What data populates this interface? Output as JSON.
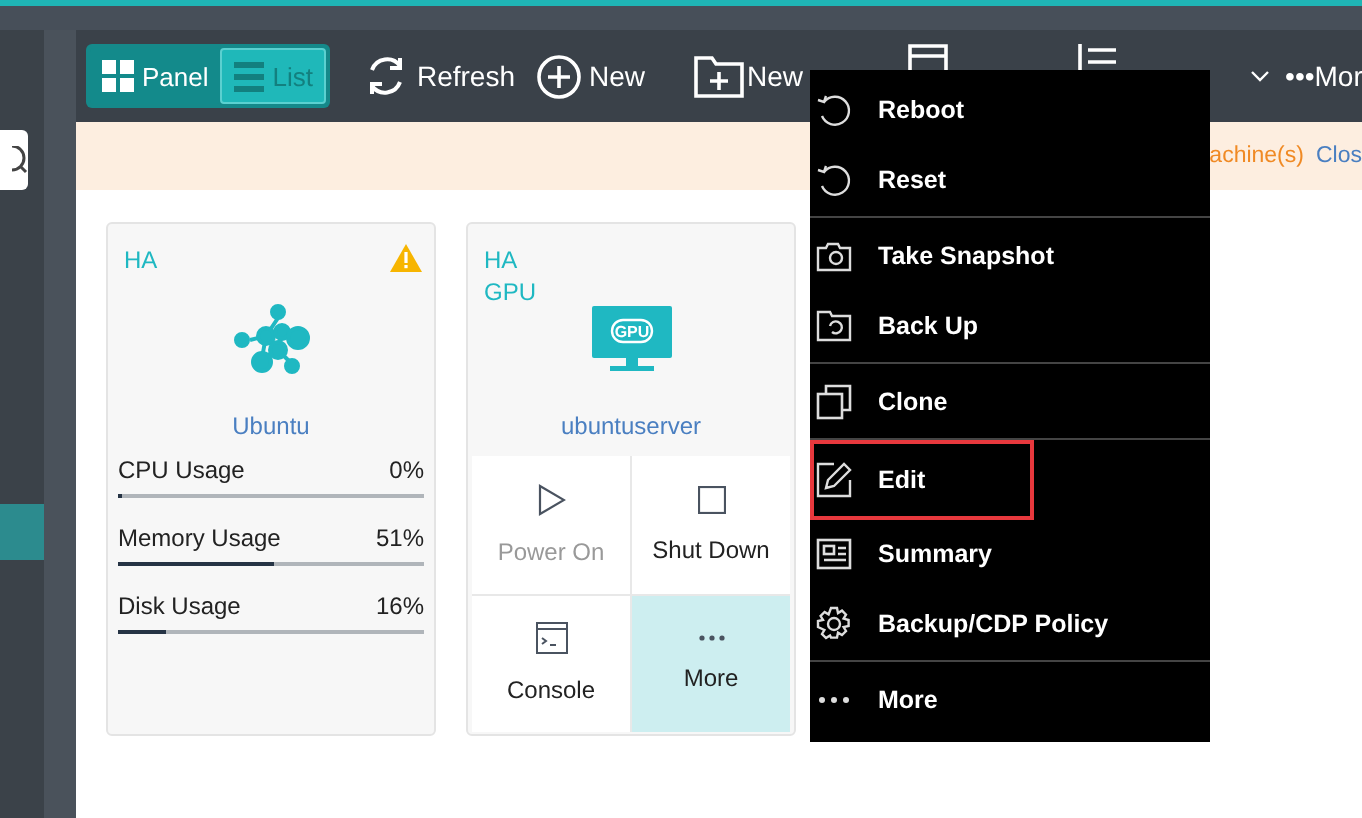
{
  "toolbar": {
    "view_toggle": [
      {
        "label": "Panel",
        "selected": true
      },
      {
        "label": "List",
        "selected": false
      }
    ],
    "buttons": [
      {
        "kind": "refresh",
        "label": "Refresh"
      },
      {
        "kind": "new",
        "label": "New"
      },
      {
        "kind": "folder",
        "label": "New"
      },
      {
        "kind": "document"
      },
      {
        "kind": "list"
      },
      {
        "kind": "chevron"
      },
      {
        "kind": "more",
        "label": "•••Mor"
      }
    ]
  },
  "notice": {
    "text": "achine(s)",
    "link": "Clos"
  },
  "cards": [
    {
      "tags": [
        "HA"
      ],
      "warning": true,
      "kind": "cluster",
      "name": "Ubuntu",
      "metrics": [
        {
          "label": "CPU Usage",
          "value": "0%",
          "level": 0
        },
        {
          "label": "Memory Usage",
          "value": "51%",
          "level": 0.51
        },
        {
          "label": "Disk Usage",
          "value": "16%",
          "level": 0.16
        }
      ]
    },
    {
      "tags": [
        "HA",
        "GPU"
      ],
      "warning": false,
      "kind": "monitor",
      "icon_label": "GPU",
      "name": "ubuntuserver",
      "actions": [
        {
          "kind": "play",
          "label": "Power On",
          "disabled": true,
          "selected": false
        },
        {
          "kind": "stop",
          "label": "Shut Down",
          "disabled": false,
          "selected": false
        },
        {
          "kind": "console",
          "label": "Console",
          "disabled": false,
          "selected": false
        },
        {
          "kind": "dots",
          "label": "More",
          "disabled": false,
          "selected": true
        }
      ]
    }
  ],
  "menu": {
    "groups": [
      [
        {
          "kind": "reboot",
          "label": "Reboot",
          "highlighted": false
        },
        {
          "kind": "reboot",
          "label": "Reset",
          "highlighted": false
        }
      ],
      [
        {
          "kind": "camera",
          "label": "Take Snapshot",
          "highlighted": false
        },
        {
          "kind": "backup",
          "label": "Back Up",
          "highlighted": false
        }
      ],
      [
        {
          "kind": "clone",
          "label": "Clone",
          "highlighted": false
        }
      ],
      [
        {
          "kind": "edit",
          "label": "Edit",
          "highlighted": true
        },
        {
          "kind": "summary",
          "label": "Summary",
          "highlighted": false
        },
        {
          "kind": "gear",
          "label": "Backup/CDP Policy",
          "highlighted": false
        }
      ],
      [
        {
          "kind": "dots",
          "label": "More",
          "highlighted": false
        }
      ]
    ]
  }
}
